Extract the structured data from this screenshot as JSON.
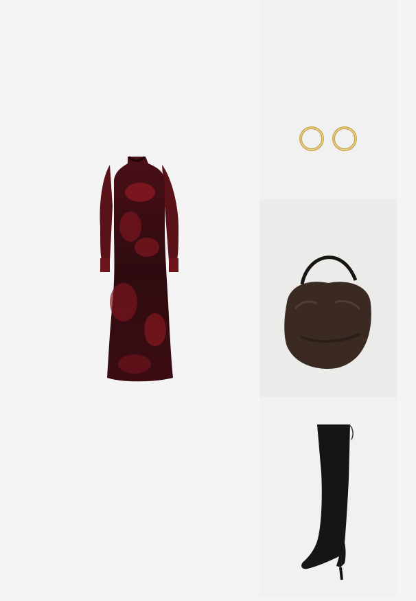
{
  "collage": {
    "items": [
      {
        "id": "dress",
        "icon": "maxi-dress-icon",
        "colors": {
          "primary": "#3a0d12",
          "accent": "#8e1a22"
        }
      },
      {
        "id": "earrings",
        "icon": "hoop-earrings-icon",
        "colors": {
          "primary": "#c9a54a"
        }
      },
      {
        "id": "bag",
        "icon": "fur-hobo-bag-icon",
        "colors": {
          "primary": "#3b2a22",
          "strap": "#1a1412"
        }
      },
      {
        "id": "boots",
        "icon": "over-knee-boot-icon",
        "colors": {
          "primary": "#151515"
        }
      }
    ]
  }
}
